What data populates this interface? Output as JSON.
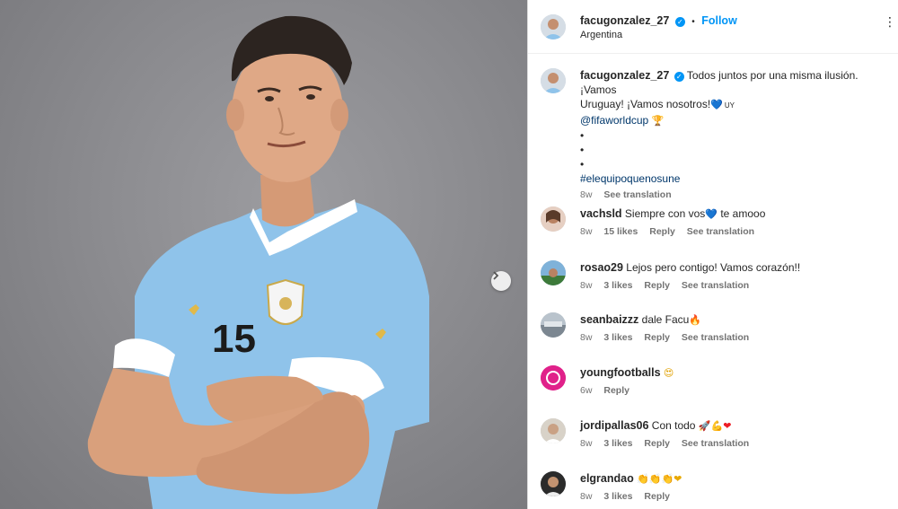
{
  "header": {
    "username": "facugonzalez_27",
    "separator": "•",
    "follow_label": "Follow",
    "location": "Argentina",
    "more_icon": "⋮"
  },
  "post": {
    "username": "facugonzalez_27",
    "caption_line1": "Todos juntos por una misma ilusión. ¡Vamos",
    "caption_line2": "Uruguay! ¡Vamos nosotros!",
    "caption_heart": "💙",
    "caption_flag": "UY",
    "mention": "@fifaworldcup",
    "trophy": "🏆",
    "dots": [
      "•",
      "•",
      "•"
    ],
    "hashtag": "#elequipoquenosune",
    "time": "8w",
    "see_translation": "See translation"
  },
  "photo": {
    "jersey_number": "15",
    "next_icon": "chevron-right-icon"
  },
  "comments": [
    {
      "username": "vachsld",
      "text": "Siempre con vos",
      "emoji": "💙",
      "text_after": "te amooo",
      "time": "8w",
      "likes": "15 likes",
      "reply": "Reply",
      "translation": "See translation"
    },
    {
      "username": "rosao29",
      "text": "Lejos pero contigo! Vamos corazón!!",
      "emoji": "",
      "text_after": "",
      "time": "8w",
      "likes": "3 likes",
      "reply": "Reply",
      "translation": "See translation"
    },
    {
      "username": "seanbaizzz",
      "text": "dale Facu",
      "emoji": "🔥",
      "text_after": "",
      "time": "8w",
      "likes": "3 likes",
      "reply": "Reply",
      "translation": "See translation"
    },
    {
      "username": "youngfootballs",
      "text": "",
      "emoji": "😍",
      "text_after": "",
      "time": "6w",
      "likes": "",
      "reply": "Reply",
      "translation": ""
    },
    {
      "username": "jordipallas06",
      "text": "Con todo",
      "emoji": "🚀💪❤",
      "text_after": "",
      "time": "8w",
      "likes": "3 likes",
      "reply": "Reply",
      "translation": "See translation"
    },
    {
      "username": "elgrandao",
      "text": "",
      "emoji": "👏👏👏❤",
      "text_after": "",
      "time": "8w",
      "likes": "3 likes",
      "reply": "Reply",
      "translation": ""
    }
  ],
  "colors": {
    "accent": "#0095f6",
    "jersey": "#8fc3ea",
    "background_photo": "#8c8c90"
  }
}
